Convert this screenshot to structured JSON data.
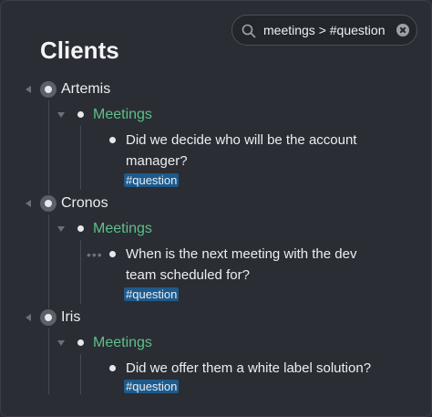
{
  "search": {
    "query": "meetings > #question"
  },
  "page": {
    "title": "Clients"
  },
  "clients": [
    {
      "name": "Artemis",
      "section": "Meetings",
      "question_lines": [
        "Did we decide who will be the account",
        "manager?"
      ],
      "tag": "#question"
    },
    {
      "name": "Cronos",
      "section": "Meetings",
      "question_lines": [
        "When is the next meeting with the dev",
        "team scheduled for?"
      ],
      "tag": "#question"
    },
    {
      "name": "Iris",
      "section": "Meetings",
      "question_lines": [
        "Did we offer them a white label solution?"
      ],
      "tag": "#question"
    }
  ],
  "icons": {
    "search": "search-icon",
    "clear": "clear-icon",
    "collapse": "collapse-triangle-icon",
    "bullet": "bullet-icon",
    "more": "more-dots-icon"
  },
  "colors": {
    "background": "#2a2d33",
    "section_green": "#5cc08a",
    "tag_blue": "#1e5a8a"
  }
}
